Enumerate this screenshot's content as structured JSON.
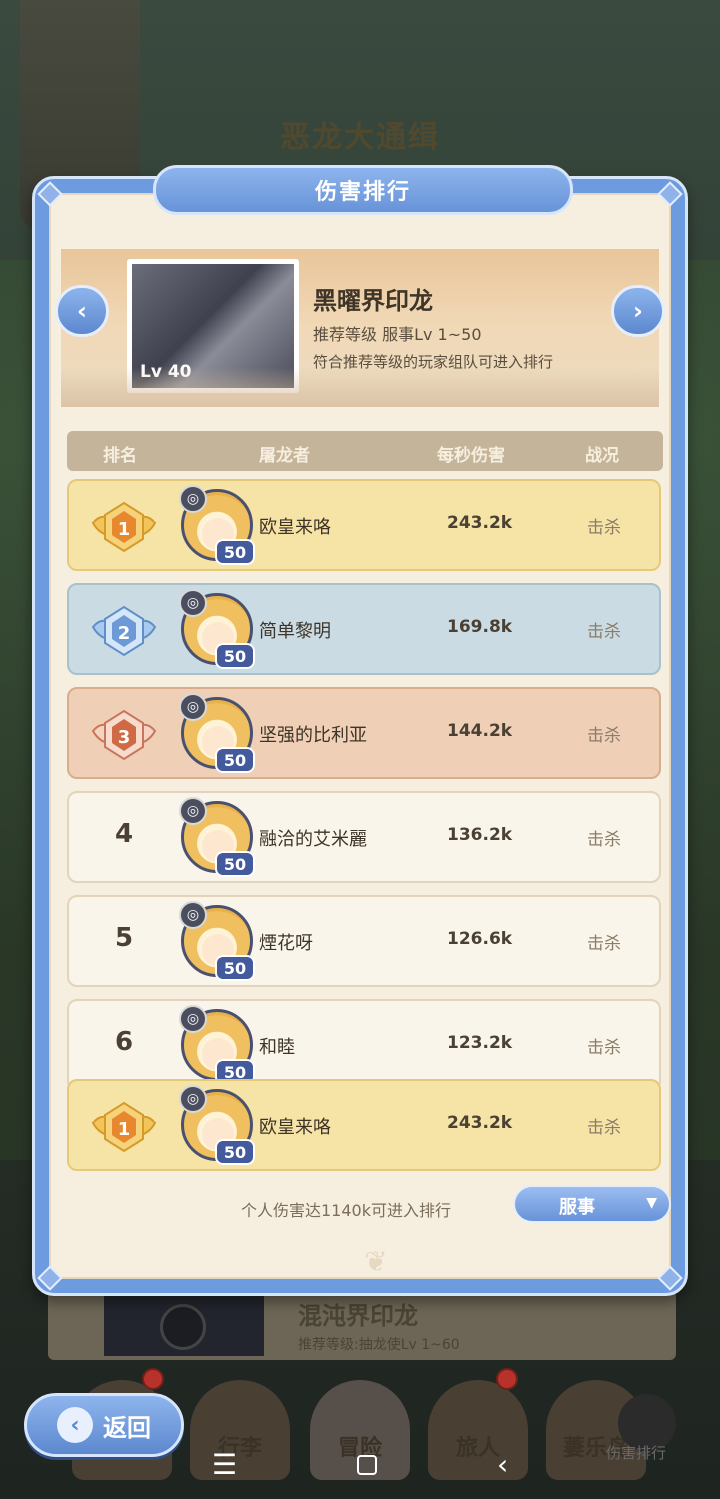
{
  "background": {
    "title": "恶龙大通缉",
    "behind_card": {
      "name": "混沌界印龙",
      "sub": "推荐等级:抽龙使Lv 1~60"
    }
  },
  "modal": {
    "title": "伤害排行",
    "boss": {
      "name": "黑曜界印龙",
      "level": "Lv 40",
      "recommend": "推荐等级 服事Lv 1~50",
      "note": "符合推荐等级的玩家组队可进入排行"
    },
    "table_headers": {
      "rank": "排名",
      "player": "屠龙者",
      "dps": "每秒伤害",
      "status": "战况"
    },
    "rows": [
      {
        "rank": "1",
        "name": "欧皇来咯",
        "level": "50",
        "dps": "243.2k",
        "status": "击杀",
        "tier": "gold"
      },
      {
        "rank": "2",
        "name": "简单黎明",
        "level": "50",
        "dps": "169.8k",
        "status": "击杀",
        "tier": "silver"
      },
      {
        "rank": "3",
        "name": "坚强的比利亚",
        "level": "50",
        "dps": "144.2k",
        "status": "击杀",
        "tier": "bronze"
      },
      {
        "rank": "4",
        "name": "融洽的艾米麗",
        "level": "50",
        "dps": "136.2k",
        "status": "击杀",
        "tier": "normal"
      },
      {
        "rank": "5",
        "name": "煙花呀",
        "level": "50",
        "dps": "126.6k",
        "status": "击杀",
        "tier": "normal"
      },
      {
        "rank": "6",
        "name": "和睦",
        "level": "50",
        "dps": "123.2k",
        "status": "击杀",
        "tier": "normal"
      }
    ],
    "self_row": {
      "rank": "1",
      "name": "欧皇来咯",
      "level": "50",
      "dps": "243.2k",
      "status": "击杀",
      "tier": "gold"
    },
    "footer_note": "个人伤害达1140k可进入排行",
    "server_select": {
      "value": "服事"
    }
  },
  "bottom_nav": {
    "items": [
      {
        "label": ""
      },
      {
        "label": "行李"
      },
      {
        "label": "冒险"
      },
      {
        "label": "旅人"
      },
      {
        "label": "萋乐岛"
      }
    ],
    "rank_label": "伤害排行"
  },
  "back_button": {
    "label": "返回"
  },
  "colors": {
    "gold": "#f6e3a6",
    "silver": "#cadbe3",
    "bronze": "#efcfb6",
    "accent": "#6c9be0"
  }
}
